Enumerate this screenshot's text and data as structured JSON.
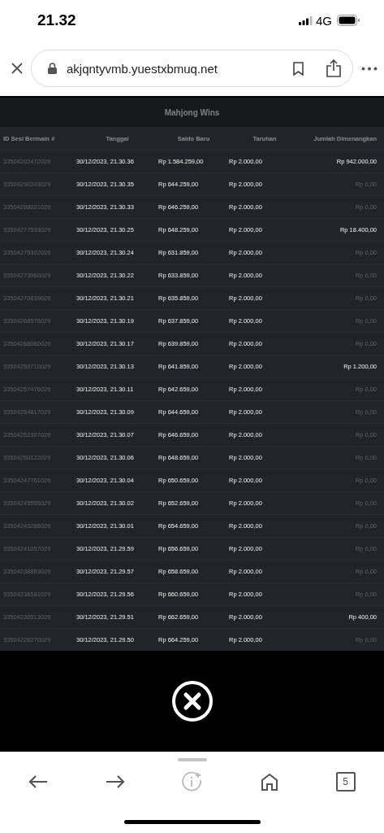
{
  "status_bar": {
    "time": "21.32",
    "network": "4G"
  },
  "browser": {
    "url": "akjqntyvmb.yuestxbmuq.net",
    "tab_count": "5"
  },
  "table": {
    "title": "Mahjong Wins",
    "columns": [
      "ID Sesi Bermain #",
      "Tanggal",
      "Saldo Baru",
      "Taruhan",
      "Jumlah Dimenangkan"
    ],
    "rows": [
      {
        "id": "33504292472029",
        "date": "30/12/2023, 21.30.36",
        "balance": "Rp 1.584.259,00",
        "bet": "Rp 2.000,00",
        "won": "Rp 942.000,00",
        "highlighted": true
      },
      {
        "id": "33504290243029",
        "date": "30/12/2023, 21.30.35",
        "balance": "Rp 644.259,00",
        "bet": "Rp 2.000,00",
        "won": "Rp 0,00",
        "highlighted": false
      },
      {
        "id": "33504288021029",
        "date": "30/12/2023, 21.30.33",
        "balance": "Rp 646.259,00",
        "bet": "Rp 2.000,00",
        "won": "Rp 0,00",
        "highlighted": false
      },
      {
        "id": "33504277533029",
        "date": "30/12/2023, 21.30.25",
        "balance": "Rp 648.259,00",
        "bet": "Rp 2.000,00",
        "won": "Rp 18.400,00",
        "highlighted": true
      },
      {
        "id": "33504275302029",
        "date": "30/12/2023, 21.30.24",
        "balance": "Rp 631.859,00",
        "bet": "Rp 2.000,00",
        "won": "Rp 0,00",
        "highlighted": false
      },
      {
        "id": "33504273060029",
        "date": "30/12/2023, 21.30.22",
        "balance": "Rp 633.859,00",
        "bet": "Rp 2.000,00",
        "won": "Rp 0,00",
        "highlighted": false
      },
      {
        "id": "33504270839029",
        "date": "30/12/2023, 21.30.21",
        "balance": "Rp 635.859,00",
        "bet": "Rp 2.000,00",
        "won": "Rp 0,00",
        "highlighted": false
      },
      {
        "id": "33504268578029",
        "date": "30/12/2023, 21.30.19",
        "balance": "Rp 637.859,00",
        "bet": "Rp 2.000,00",
        "won": "Rp 0,00",
        "highlighted": false
      },
      {
        "id": "33504266060029",
        "date": "30/12/2023, 21.30.17",
        "balance": "Rp 639.859,00",
        "bet": "Rp 2.000,00",
        "won": "Rp 0,00",
        "highlighted": false
      },
      {
        "id": "33504259710029",
        "date": "30/12/2023, 21.30.13",
        "balance": "Rp 641.859,00",
        "bet": "Rp 2.000,00",
        "won": "Rp 1.200,00",
        "highlighted": true
      },
      {
        "id": "33504257476029",
        "date": "30/12/2023, 21.30.11",
        "balance": "Rp 642.659,00",
        "bet": "Rp 2.000,00",
        "won": "Rp 0,00",
        "highlighted": false
      },
      {
        "id": "33504254817029",
        "date": "30/12/2023, 21.30.09",
        "balance": "Rp 644.659,00",
        "bet": "Rp 2.000,00",
        "won": "Rp 0,00",
        "highlighted": false
      },
      {
        "id": "33504252397029",
        "date": "30/12/2023, 21.30.07",
        "balance": "Rp 646.659,00",
        "bet": "Rp 2.000,00",
        "won": "Rp 0,00",
        "highlighted": false
      },
      {
        "id": "33504250122029",
        "date": "30/12/2023, 21.30.06",
        "balance": "Rp 648.659,00",
        "bet": "Rp 2.000,00",
        "won": "Rp 0,00",
        "highlighted": false
      },
      {
        "id": "33504247761029",
        "date": "30/12/2023, 21.30.04",
        "balance": "Rp 650.659,00",
        "bet": "Rp 2.000,00",
        "won": "Rp 0,00",
        "highlighted": false
      },
      {
        "id": "33504245555029",
        "date": "30/12/2023, 21.30.02",
        "balance": "Rp 652.659,00",
        "bet": "Rp 2.000,00",
        "won": "Rp 0,00",
        "highlighted": false
      },
      {
        "id": "33504243288029",
        "date": "30/12/2023, 21.30.01",
        "balance": "Rp 654.659,00",
        "bet": "Rp 2.000,00",
        "won": "Rp 0,00",
        "highlighted": false
      },
      {
        "id": "33504241057029",
        "date": "30/12/2023, 21.29.59",
        "balance": "Rp 656.659,00",
        "bet": "Rp 2.000,00",
        "won": "Rp 0,00",
        "highlighted": false
      },
      {
        "id": "33504238853029",
        "date": "30/12/2023, 21.29.57",
        "balance": "Rp 658.659,00",
        "bet": "Rp 2.000,00",
        "won": "Rp 0,00",
        "highlighted": false
      },
      {
        "id": "33504236581029",
        "date": "30/12/2023, 21.29.56",
        "balance": "Rp 660.659,00",
        "bet": "Rp 2.000,00",
        "won": "Rp 0,00",
        "highlighted": false
      },
      {
        "id": "33504230513029",
        "date": "30/12/2023, 21.29.51",
        "balance": "Rp 662.659,00",
        "bet": "Rp 2.000,00",
        "won": "Rp 400,00",
        "highlighted": true
      },
      {
        "id": "33504228270029",
        "date": "30/12/2023, 21.29.50",
        "balance": "Rp 664.259,00",
        "bet": "Rp 2.000,00",
        "won": "Rp 0,00",
        "highlighted": false
      }
    ]
  }
}
